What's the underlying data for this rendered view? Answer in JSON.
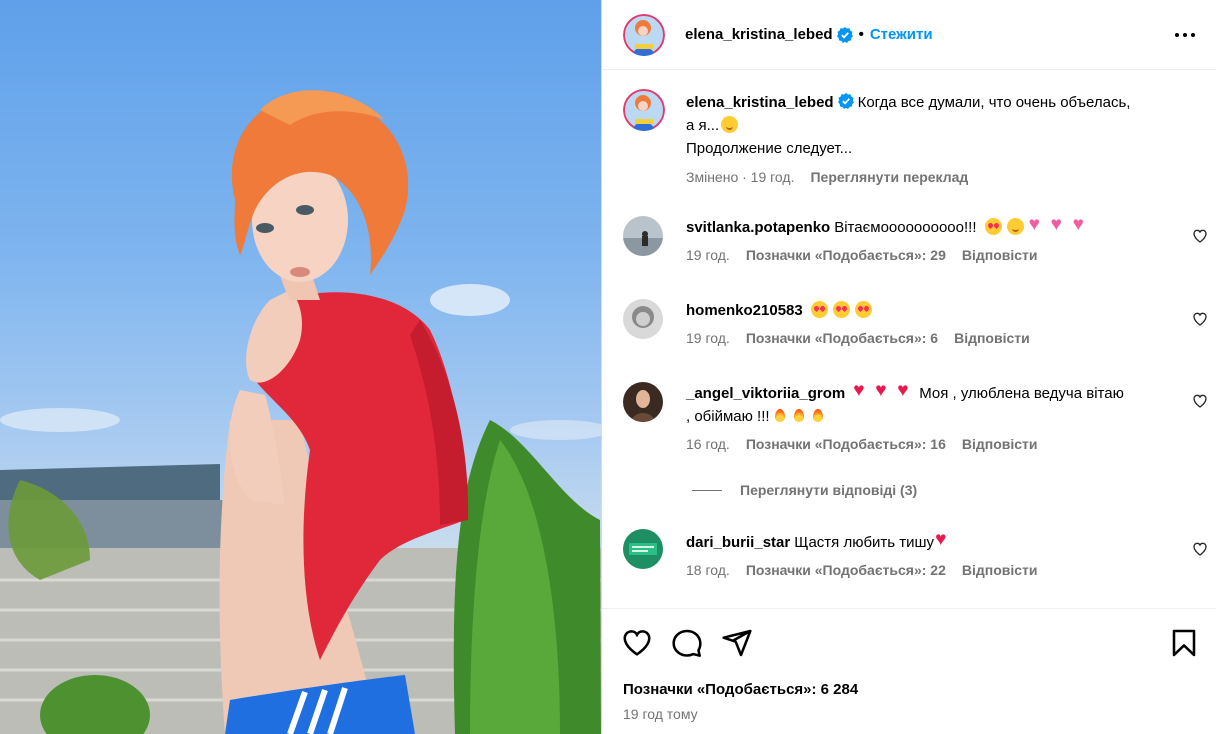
{
  "post": {
    "username": "elena_kristina_lebed",
    "follow_label": "Стежити",
    "dot": "•",
    "caption_line1": "Когда все думали, что очень объелась,",
    "caption_line2": "а я...",
    "caption_line3": "Продолжение следует...",
    "caption_meta_edited": "Змінено · 19 год.",
    "caption_meta_translate": "Переглянути переклад"
  },
  "comments": [
    {
      "username": "svitlanka.potapenko",
      "text": "Вітаємоооооооооо!!!",
      "time": "19 год.",
      "likes": "Позначки «Подобається»: 29",
      "reply": "Відповісти"
    },
    {
      "username": "homenko210583",
      "text": "",
      "time": "19 год.",
      "likes": "Позначки «Подобається»: 6",
      "reply": "Відповісти"
    },
    {
      "username": "_angel_viktoriia_grom",
      "text": "Моя , улюблена ведуча вітаю",
      "text2": ", обіймаю !!!",
      "time": "16 год.",
      "likes": "Позначки «Подобається»: 16",
      "reply": "Відповісти",
      "view_replies": "Переглянути відповіді (3)"
    },
    {
      "username": "dari_burii_star",
      "text": "Щастя любить тишу",
      "time": "18 год.",
      "likes": "Позначки «Подобається»: 22",
      "reply": "Відповісти"
    }
  ],
  "footer": {
    "likes_total": "Позначки «Подобається»: 6 284",
    "time_ago": "19 год тому"
  },
  "icons": [
    "verified-icon",
    "more-options-icon",
    "heart-icon",
    "comment-icon",
    "share-icon",
    "bookmark-icon"
  ],
  "colors": {
    "accent": "#0095f6",
    "verified": "#0095f6",
    "muted": "#737373",
    "shirt": "#e0283a"
  }
}
